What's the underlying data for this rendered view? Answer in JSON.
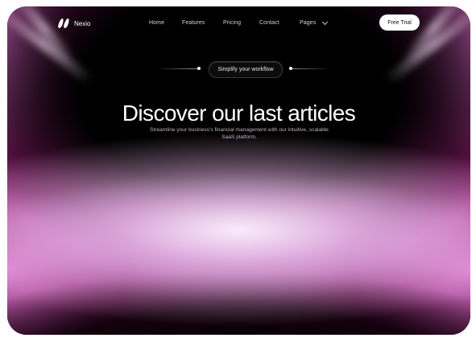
{
  "brand": {
    "name": "Nexio",
    "logo_icon": "nexio-logo-icon"
  },
  "nav": {
    "links": [
      "Home",
      "Features",
      "Pricing",
      "Contact",
      "Pages"
    ],
    "pages_icon": "chevron-down-icon",
    "cta_label": "Free Trial"
  },
  "hero": {
    "badge": "Simplify your workflow",
    "title": "Discover our last articles",
    "subtitle": "Streamline your business's financial management with our intuitive, scalable SaaS platform."
  },
  "colors": {
    "background": "#000000",
    "glow": "#e7a3df",
    "accent": "#5a1446",
    "cta_bg": "#ffffff"
  }
}
